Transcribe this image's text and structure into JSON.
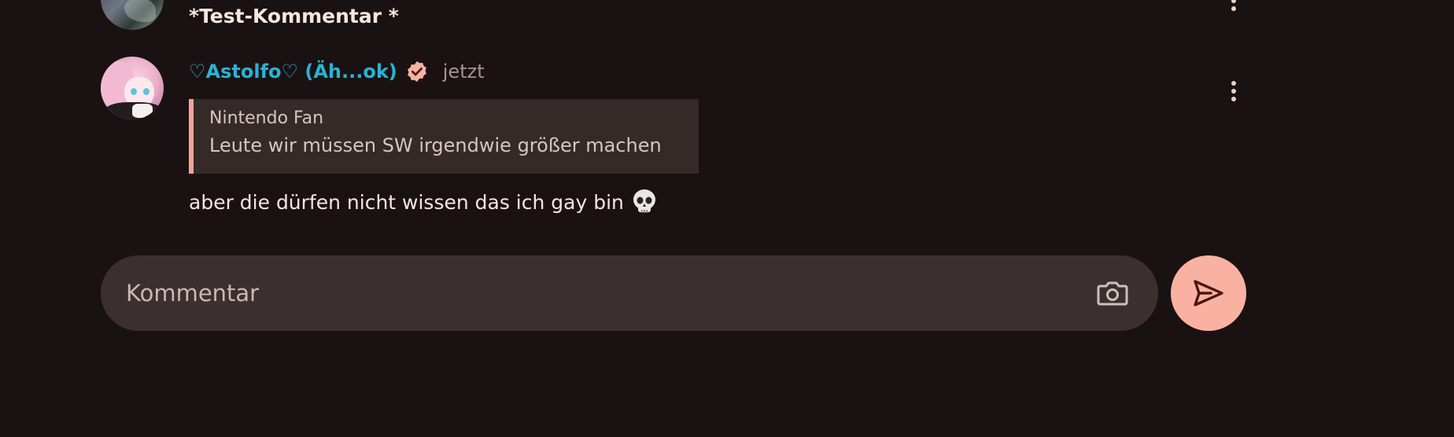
{
  "previous_comment": {
    "text": "*Test-Kommentar *"
  },
  "comment": {
    "username": "♡Astolfo♡ (Äh...ok)",
    "verified_icon": "verified-badge-icon",
    "timestamp": "jetzt",
    "reply_to": {
      "author": "Nintendo Fan",
      "text": "Leute wir müssen SW irgendwie größer machen"
    },
    "message": "aber die dürfen nicht wissen das ich gay bin",
    "emoji_icon": "skull-icon"
  },
  "composer": {
    "placeholder": "Kommentar",
    "camera_icon": "camera-icon",
    "send_icon": "send-icon"
  },
  "colors": {
    "background": "#1a1212",
    "username": "#29b3d4",
    "accent": "#f9b2a2",
    "quote_bar": "#f3a594",
    "quote_bg": "#362a29",
    "composer_bg": "#3b302f"
  }
}
